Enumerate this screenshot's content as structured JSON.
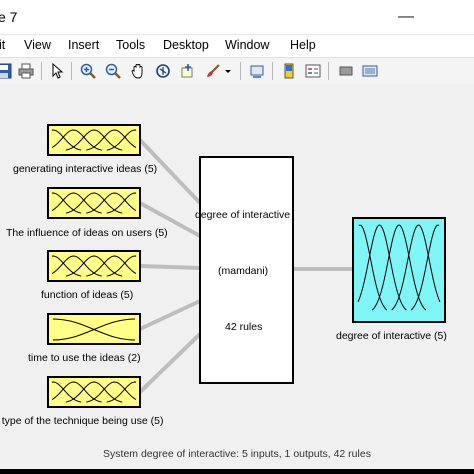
{
  "window": {
    "title": "e 7"
  },
  "controls": {
    "minimize": "—"
  },
  "menu": [
    "it",
    "View",
    "Insert",
    "Tools",
    "Desktop",
    "Window",
    "Help"
  ],
  "toolbar_icons": [
    "save-icon",
    "print-icon",
    "pointer-icon",
    "zoom-in-icon",
    "zoom-out-icon",
    "pan-icon",
    "rotate-icon",
    "data-cursor-icon",
    "brush-icon",
    "brush-dropdown-icon",
    "link-icon",
    "colorbar-icon",
    "legend-icon",
    "hide-plot-tools-icon",
    "show-plot-tools-icon"
  ],
  "colors": {
    "input_mf": "#ffff88",
    "output_mf": "#7ff5f5",
    "connector": "#bdbdbd"
  },
  "inputs": [
    {
      "label": "generating interactive ideas  (5)",
      "mfs": 5
    },
    {
      "label": "The influence of ideas on users (5)",
      "mfs": 5
    },
    {
      "label": "function of ideas  (5)",
      "mfs": 5
    },
    {
      "label": "time to use the  ideas  (2)",
      "mfs": 2
    },
    {
      "label": "e  type of the technique being  use (5)",
      "mfs": 5
    }
  ],
  "system": {
    "name": "degree of interactive",
    "type": "(mamdani)",
    "rules": "42 rules"
  },
  "output": {
    "label": "degree of interactive (5)",
    "mfs": 5
  },
  "status": "System degree of interactive: 5 inputs, 1 outputs, 42 rules"
}
